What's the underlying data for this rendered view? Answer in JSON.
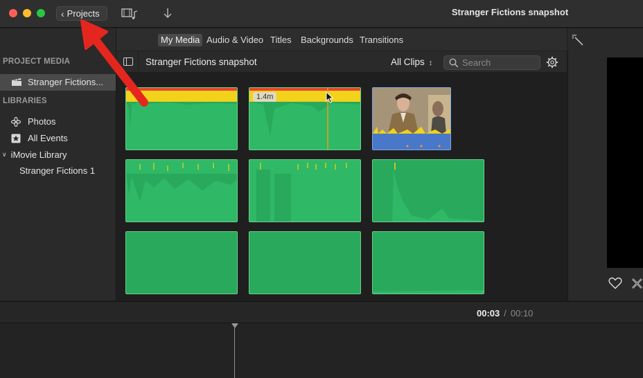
{
  "titlebar": {
    "back_button_label": "Projects",
    "window_title": "Stranger Fictions snapshot"
  },
  "tabs": [
    {
      "label": "My Media",
      "active": true
    },
    {
      "label": "Audio & Video",
      "active": false
    },
    {
      "label": "Titles",
      "active": false
    },
    {
      "label": "Backgrounds",
      "active": false
    },
    {
      "label": "Transitions",
      "active": false
    }
  ],
  "sidebar": {
    "project_media_heading": "PROJECT MEDIA",
    "project_item": "Stranger Fictions...",
    "libraries_heading": "LIBRARIES",
    "photos": "Photos",
    "all_events": "All Events",
    "library": "iMovie Library",
    "event": "Stranger Fictions 1"
  },
  "browser": {
    "title": "Stranger Fictions snapshot",
    "filter": "All Clips",
    "search_placeholder": "Search"
  },
  "clips": {
    "skimmed_duration": "1.4m"
  },
  "timeline": {
    "current_time": "00:03",
    "separator": "/",
    "total_time": "00:10"
  },
  "colors": {
    "audio_green": "#2fb866",
    "peak_yellow": "#f2d21b",
    "peak_red": "#e8452e",
    "annotation_red": "#e5261f"
  },
  "icons": [
    "chevron-left-icon",
    "media-browser-icon",
    "import-arrow-icon",
    "clapperboard-icon",
    "photos-icon",
    "star-icon",
    "disclosure-triangle-icon",
    "sidebar-toggle-icon",
    "search-icon",
    "gear-icon",
    "magic-wand-icon",
    "heart-icon",
    "reject-icon"
  ]
}
